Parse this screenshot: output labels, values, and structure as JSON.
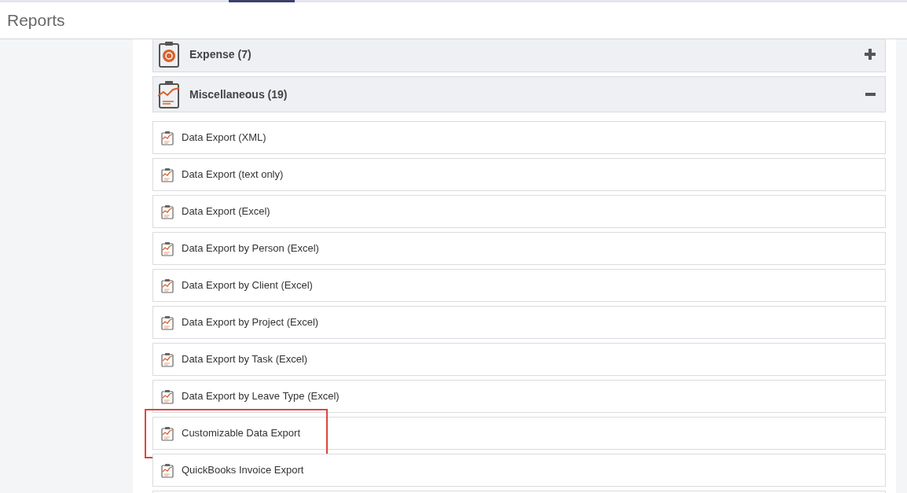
{
  "header": {
    "title": "Reports"
  },
  "categories": [
    {
      "label": "Expense (7)",
      "kind": "expense",
      "expanded": false
    },
    {
      "label": "Miscellaneous (19)",
      "kind": "misc",
      "expanded": true,
      "items": [
        {
          "label": "Data Export (XML)",
          "highlighted": false
        },
        {
          "label": "Data Export (text only)",
          "highlighted": false
        },
        {
          "label": "Data Export (Excel)",
          "highlighted": false
        },
        {
          "label": "Data Export by Person (Excel)",
          "highlighted": false
        },
        {
          "label": "Data Export by Client (Excel)",
          "highlighted": false
        },
        {
          "label": "Data Export by Project (Excel)",
          "highlighted": false
        },
        {
          "label": "Data Export by Task (Excel)",
          "highlighted": false
        },
        {
          "label": "Data Export by Leave Type (Excel)",
          "highlighted": false
        },
        {
          "label": "Customizable Data Export",
          "highlighted": true
        },
        {
          "label": "QuickBooks Invoice Export",
          "highlighted": false
        }
      ]
    }
  ]
}
